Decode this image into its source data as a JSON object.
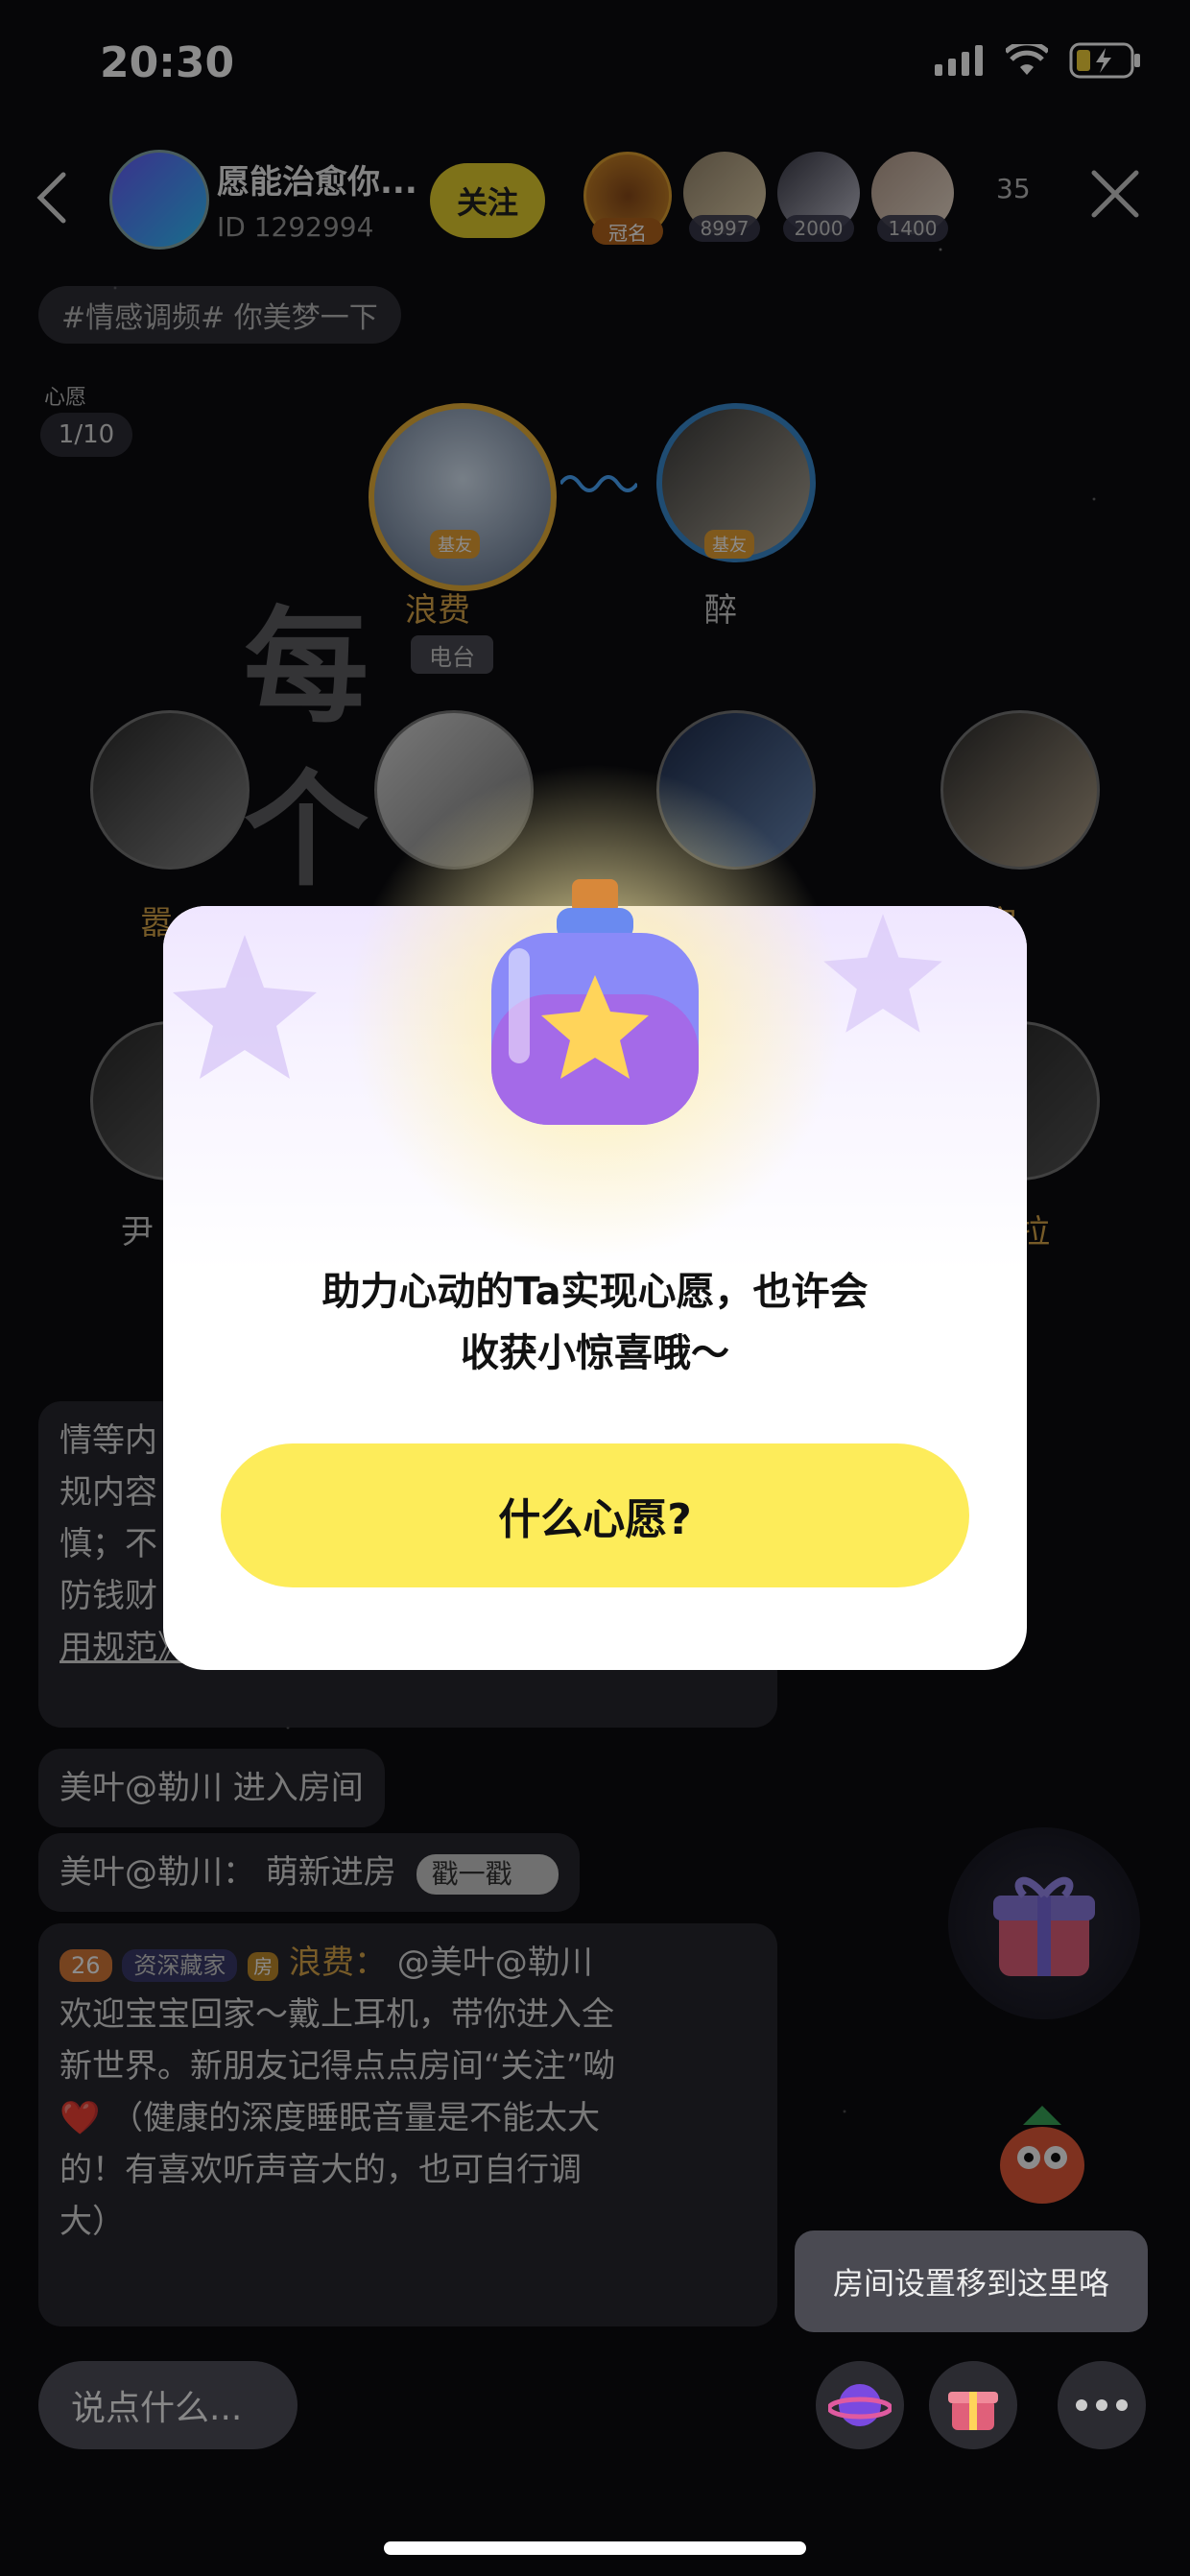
{
  "status_bar": {
    "time": "20:30"
  },
  "header": {
    "room_title": "愿能治愈你...",
    "room_id": "ID 1292994",
    "follow_label": "关注",
    "viewers": [
      {
        "label": "冠名"
      },
      {
        "label": "8997"
      },
      {
        "label": "2000"
      },
      {
        "label": "1400"
      }
    ],
    "viewer_count": "35"
  },
  "room_tag": "#情感调频#  你美梦一下",
  "wish": {
    "label": "心愿",
    "count": "1/10"
  },
  "bubble_text": "@美叶@勒川 欢迎宝宝回家...",
  "host_seats": [
    {
      "name": "浪费",
      "badge": "基友",
      "tag": "电台"
    },
    {
      "name": "醉",
      "badge": "基友"
    }
  ],
  "row2_names": [
    "嚣",
    "",
    "",
    "安"
  ],
  "row3_names": [
    "尹",
    "拉"
  ],
  "big_chars": [
    "每",
    "个"
  ],
  "chat": {
    "rules_lines": [
      "情等内",
      "规内容",
      "慎；不",
      "防钱财",
      "用规范》。"
    ],
    "enter_msg": "美叶@勒川  进入房间",
    "new_msg": "美叶@勒川：  萌新进房",
    "poke_label": "戳一戳",
    "host_msg": {
      "level": "26",
      "title": "资深藏家",
      "fang": "房",
      "sender": "浪费：",
      "text_lines": [
        "@美叶@勒川",
        "欢迎宝宝回家～戴上耳机，带你进入全",
        "新世界。新朋友记得点点房间“关注”呦",
        "❤️ （健康的深度睡眠音量是不能太大",
        "的！有喜欢听声音大的，也可自行调",
        "大）"
      ]
    }
  },
  "modal": {
    "text_line1": "助力心动的Ta实现心愿，也许会",
    "text_line2": "收获小惊喜哦～",
    "button_label": "什么心愿?"
  },
  "bottom": {
    "input_placeholder": "说点什么...",
    "tooltip": "房间设置移到这里咯"
  },
  "colors": {
    "accent_yellow": "#fdec5a",
    "follow_yellow": "#e6cf2f",
    "gold": "#d9a64a"
  }
}
